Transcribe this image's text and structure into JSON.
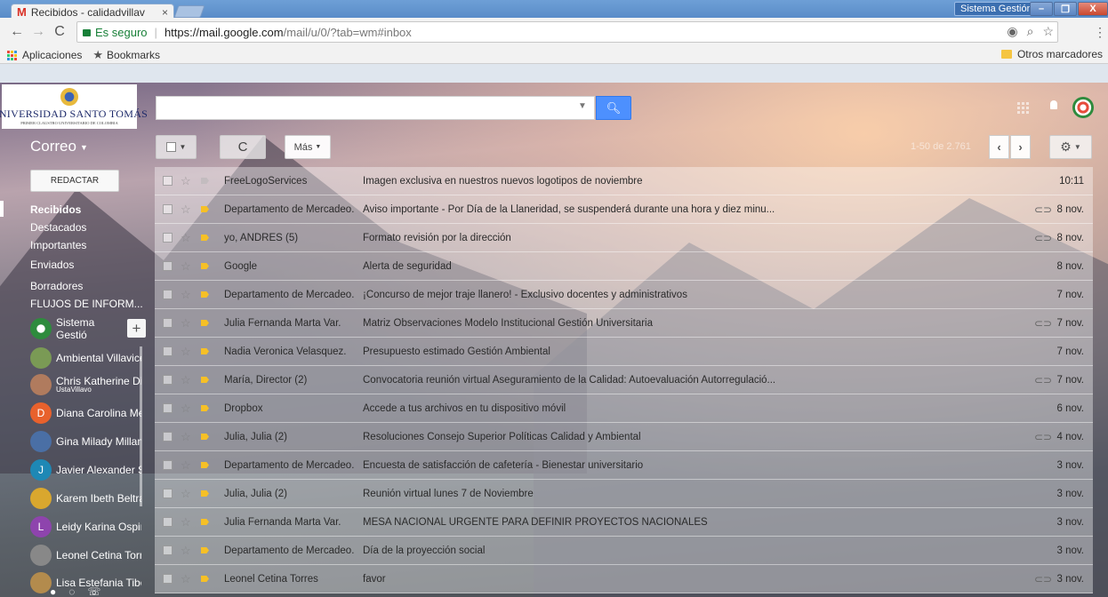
{
  "browser": {
    "tab_title": "Recibidos - calidadvillav",
    "tab_close": "×",
    "profile_name": "Sistema Gestión",
    "win_min": "–",
    "win_max": "❐",
    "win_close": "X",
    "url_secure_label": "Es seguro",
    "url_host": "https://mail.google.com",
    "url_path": "/mail/u/0/?tab=wm#inbox",
    "bookmarks": [
      "Aplicaciones",
      "Bookmarks"
    ],
    "other_bookmarks": "Otros marcadores"
  },
  "brand": {
    "university": "UNIVERSIDAD SANTO TOMÁS",
    "university_sub": "PRIMER CLAUSTRO UNIVERSITARIO DE COLOMBIA"
  },
  "toolbar": {
    "app_label": "Correo",
    "more_label": "Más",
    "pager_text": "1-50 de 2.761"
  },
  "sidebar": {
    "compose_label": "REDACTAR",
    "folders": [
      "Recibidos",
      "Destacados",
      "Importantes",
      "Enviados",
      "Borradores",
      "FLUJOS DE INFORM..."
    ],
    "hangout_user": "Sistema Gestió",
    "contacts": [
      {
        "name": "Ambiental Villavice",
        "status": "",
        "initial": "",
        "color": "#7a9a55"
      },
      {
        "name": "Chris Katherine Di",
        "status": "UstaVillavo",
        "initial": "",
        "color": "#b07b5e"
      },
      {
        "name": "Diana Carolina Me",
        "status": "",
        "initial": "D",
        "color": "#e8612c"
      },
      {
        "name": "Gina Milady Millan",
        "status": "",
        "initial": "",
        "color": "#4a6fa5"
      },
      {
        "name": "Javier Alexander S",
        "status": "",
        "initial": "J",
        "color": "#1e88b5"
      },
      {
        "name": "Karem Ibeth Beltrá",
        "status": "",
        "initial": "",
        "color": "#d9a72e"
      },
      {
        "name": "Leidy Karina Ospir",
        "status": "",
        "initial": "L",
        "color": "#8e44ad"
      },
      {
        "name": "Leonel Cetina Torr",
        "status": "",
        "initial": "",
        "color": "#888888"
      },
      {
        "name": "Lisa Estefania Tibo",
        "status": "",
        "initial": "",
        "color": "#b38b4d"
      }
    ]
  },
  "emails": [
    {
      "sender": "FreeLogoServices",
      "subject": "Imagen exclusiva en nuestros nuevos logotipos de noviembre",
      "date": "10:11",
      "attachment": false,
      "important": false
    },
    {
      "sender": "Departamento de Mercadeo.",
      "subject": "Aviso importante - Por Día de la Llaneridad, se suspenderá durante una hora y diez minu...",
      "date": "8 nov.",
      "attachment": true,
      "important": true
    },
    {
      "sender": "yo, ANDRES (5)",
      "subject": "Formato revisión por la dirección",
      "date": "8 nov.",
      "attachment": true,
      "important": true
    },
    {
      "sender": "Google",
      "subject": "Alerta de seguridad",
      "date": "8 nov.",
      "attachment": false,
      "important": true
    },
    {
      "sender": "Departamento de Mercadeo.",
      "subject": "¡Concurso de mejor traje llanero! - Exclusivo docentes y administrativos",
      "date": "7 nov.",
      "attachment": false,
      "important": true
    },
    {
      "sender": "Julia Fernanda Marta Var.",
      "subject": "Matriz Observaciones Modelo Institucional Gestión Universitaria",
      "date": "7 nov.",
      "attachment": true,
      "important": true
    },
    {
      "sender": "Nadia Veronica Velasquez.",
      "subject": "Presupuesto estimado Gestión Ambiental",
      "date": "7 nov.",
      "attachment": false,
      "important": true
    },
    {
      "sender": "María, Director (2)",
      "subject": "Convocatoria reunión virtual Aseguramiento de la Calidad: Autoevaluación Autorregulació...",
      "date": "7 nov.",
      "attachment": true,
      "important": true
    },
    {
      "sender": "Dropbox",
      "subject": "Accede a tus archivos en tu dispositivo móvil",
      "date": "6 nov.",
      "attachment": false,
      "important": true
    },
    {
      "sender": "Julia, Julia (2)",
      "subject": "Resoluciones Consejo Superior Políticas Calidad y Ambiental",
      "date": "4 nov.",
      "attachment": true,
      "important": true
    },
    {
      "sender": "Departamento de Mercadeo.",
      "subject": "Encuesta de satisfacción de cafetería - Bienestar universitario",
      "date": "3 nov.",
      "attachment": false,
      "important": true
    },
    {
      "sender": "Julia, Julia (2)",
      "subject": "Reunión virtual lunes 7 de Noviembre",
      "date": "3 nov.",
      "attachment": false,
      "important": true
    },
    {
      "sender": "Julia Fernanda Marta Var.",
      "subject": "MESA NACIONAL URGENTE PARA DEFINIR PROYECTOS NACIONALES",
      "date": "3 nov.",
      "attachment": false,
      "important": true
    },
    {
      "sender": "Departamento de Mercadeo.",
      "subject": "Día de la proyección social",
      "date": "3 nov.",
      "attachment": false,
      "important": true
    },
    {
      "sender": "Leonel Cetina Torres",
      "subject": "favor",
      "date": "3 nov.",
      "attachment": true,
      "important": true
    }
  ]
}
